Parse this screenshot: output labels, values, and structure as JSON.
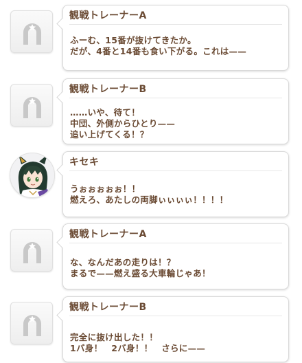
{
  "entries": [
    {
      "speaker": "観戦トレーナーA",
      "avatar_icon": "horseshoe-placeholder-icon",
      "text": "ふーむ、15番が抜けてきたか。\nだが、4番と14番も食い下がる。これは——"
    },
    {
      "speaker": "観戦トレーナーB",
      "avatar_icon": "horseshoe-placeholder-icon",
      "text": "……いや、待て！\n中団、外側からひとり——\n追い上げてくる！？"
    },
    {
      "speaker": "キセキ",
      "avatar_icon": "character-portrait-icon",
      "text": "うぉぉぉぉぉ！！\n燃えろ、あたしの両脚ぃぃぃぃ！！！！"
    },
    {
      "speaker": "観戦トレーナーA",
      "avatar_icon": "horseshoe-placeholder-icon",
      "text": "な、なんだあの走りは！？\nまるで——燃え盛る大車輪じゃあ！"
    },
    {
      "speaker": "観戦トレーナーB",
      "avatar_icon": "horseshoe-placeholder-icon",
      "text": "完全に抜け出した！！\n1バ身！　2バ身！！　さらに——"
    }
  ],
  "colors": {
    "text": "#6a4a33",
    "bubble_border": "#d9d9d9",
    "placeholder_gray": "#c8c8c8"
  }
}
